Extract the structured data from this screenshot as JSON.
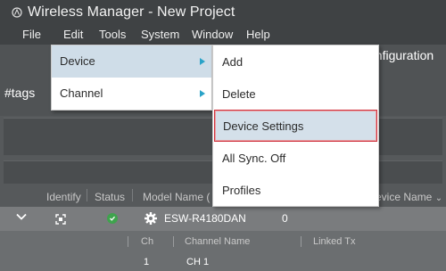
{
  "window": {
    "title": "Wireless Manager - New Project"
  },
  "menubar": {
    "items": [
      "File",
      "Edit",
      "Tools",
      "System",
      "Window",
      "Help"
    ]
  },
  "background": {
    "configuration_text": "onfiguration",
    "tags_text": "#tags"
  },
  "table": {
    "columns": [
      "Identify",
      "Status",
      "Model Name (",
      "evice Name"
    ],
    "device_row": {
      "model": "ESW-R4180DAN",
      "value": "0",
      "status": "online"
    },
    "sub_columns": [
      "Ch",
      "Channel Name",
      "Linked Tx"
    ],
    "channel_row": {
      "ch": "1",
      "name": "CH 1"
    }
  },
  "edit_menu": {
    "items": [
      {
        "label": "Device",
        "has_submenu": true,
        "highlighted": true
      },
      {
        "label": "Channel",
        "has_submenu": true,
        "highlighted": false
      }
    ]
  },
  "device_submenu": {
    "items": [
      {
        "label": "Add"
      },
      {
        "label": "Delete"
      },
      {
        "label": "Device Settings",
        "focused": true
      },
      {
        "label": "All Sync. Off"
      },
      {
        "label": "Profiles"
      }
    ]
  },
  "colors": {
    "accent_arrow": "#2aa3c8",
    "focus_border": "#d0313c",
    "status_ok": "#3fa34d"
  }
}
